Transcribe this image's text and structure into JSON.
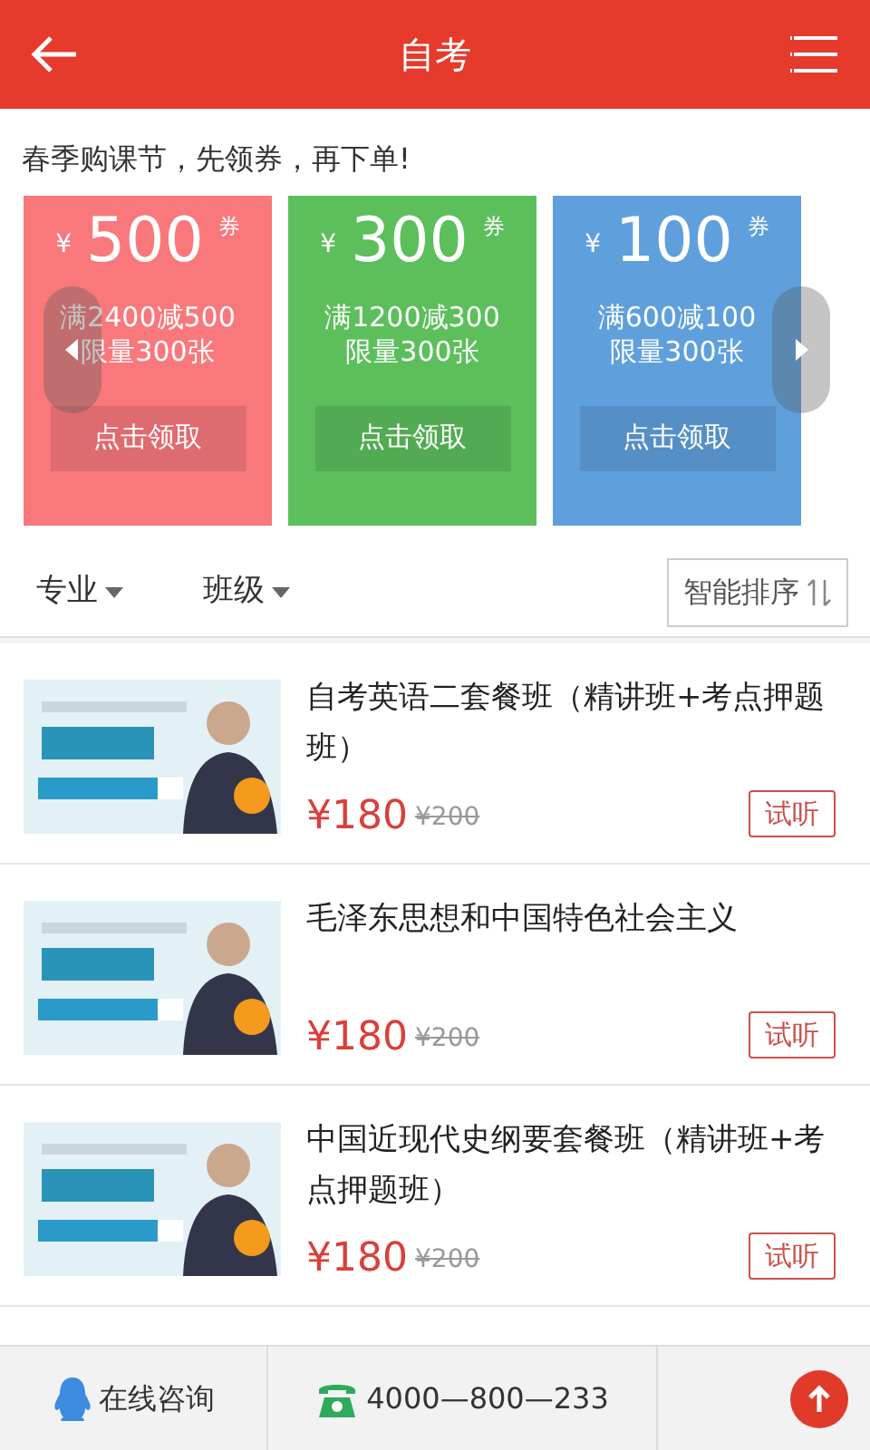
{
  "header": {
    "title": "自考"
  },
  "promo": "春季购课节，先领券，再下单!",
  "coupons": [
    {
      "currency": "¥",
      "amount": "500",
      "unit": "券",
      "condition": "满2400减500",
      "limit": "限量300张",
      "button": "点击领取",
      "color": "#f8787c"
    },
    {
      "currency": "¥",
      "amount": "300",
      "unit": "券",
      "condition": "满1200减300",
      "limit": "限量300张",
      "button": "点击领取",
      "color": "#5cbf5c"
    },
    {
      "currency": "¥",
      "amount": "100",
      "unit": "券",
      "condition": "满600减100",
      "limit": "限量300张",
      "button": "点击领取",
      "color": "#5fa0dc"
    }
  ],
  "filters": [
    {
      "label": "专业"
    },
    {
      "label": "班级"
    }
  ],
  "sort": {
    "label": "智能排序"
  },
  "courses": [
    {
      "title": "自考英语二套餐班（精讲班+考点押题班）",
      "price": "¥180",
      "original_price": "¥200",
      "trial": "试听"
    },
    {
      "title": "毛泽东思想和中国特色社会主义",
      "price": "¥180",
      "original_price": "¥200",
      "trial": "试听"
    },
    {
      "title": "中国近现代史纲要套餐班（精讲班+考点押题班）",
      "price": "¥180",
      "original_price": "¥200",
      "trial": "试听"
    }
  ],
  "footer": {
    "consult": "在线咨询",
    "phone": "4000—800—233"
  }
}
